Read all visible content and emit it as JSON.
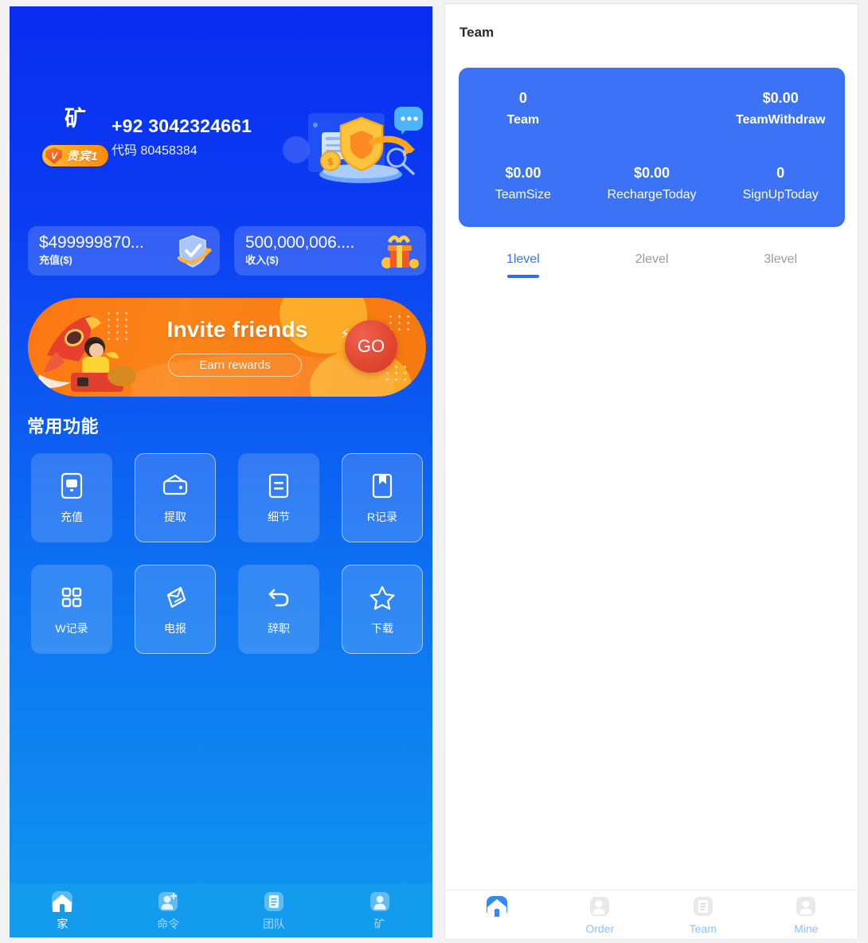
{
  "left_app": {
    "profile": {
      "avatar_name": "矿",
      "vip_mark": "V",
      "vip_label": "贵宾1",
      "phone": "+92 3042324661",
      "invite_code_text": "代码 80458384"
    },
    "balances": [
      {
        "amount": "$499999870...",
        "label": "充值($)",
        "icon": "shield-check-icon"
      },
      {
        "amount": "500,000,006....",
        "label": "收入($)",
        "icon": "gift-box-icon"
      }
    ],
    "banner": {
      "title": "Invite friends",
      "subtitle": "Earn rewards",
      "cta": "GO",
      "icon": "rocket-icon"
    },
    "section_title": "常用功能",
    "functions": [
      {
        "label": "充值",
        "icon": "monitor-icon",
        "style": "filled"
      },
      {
        "label": "提取",
        "icon": "wallet-icon",
        "style": "outlined"
      },
      {
        "label": "细节",
        "icon": "document-lines-icon",
        "style": "filled"
      },
      {
        "label": "R记录",
        "icon": "bookmark-book-icon",
        "style": "outlined"
      },
      {
        "label": "W记录",
        "icon": "grid-squares-icon",
        "style": "filled"
      },
      {
        "label": "电报",
        "icon": "send-card-icon",
        "style": "outlined"
      },
      {
        "label": "辞职",
        "icon": "undo-arrow-icon",
        "style": "filled"
      },
      {
        "label": "下载",
        "icon": "star-icon",
        "style": "outlined"
      }
    ],
    "bottom_nav": [
      {
        "label": "家",
        "icon": "home-icon",
        "active": true
      },
      {
        "label": "命令",
        "icon": "user-plus-icon",
        "active": false
      },
      {
        "label": "团队",
        "icon": "document-icon",
        "active": false
      },
      {
        "label": "矿",
        "icon": "user-icon",
        "active": false
      }
    ]
  },
  "right_app": {
    "page_title": "Team",
    "team_card": {
      "row1": [
        {
          "value": "0",
          "key": "Team"
        },
        {
          "value": "",
          "key": ""
        },
        {
          "value": "$0.00",
          "key": "TeamWithdraw"
        }
      ],
      "row2": [
        {
          "value": "$0.00",
          "key": "TeamSize"
        },
        {
          "value": "$0.00",
          "key": "RechargeToday"
        },
        {
          "value": "0",
          "key": "SignUpToday"
        }
      ]
    },
    "level_tabs": [
      {
        "label": "1level",
        "active": true
      },
      {
        "label": "2level",
        "active": false
      },
      {
        "label": "3level",
        "active": false
      }
    ],
    "bottom_nav": [
      {
        "label": "Home",
        "icon": "home-icon",
        "active": true
      },
      {
        "label": "Order",
        "icon": "user-plus-icon",
        "active": false
      },
      {
        "label": "Team",
        "icon": "document-icon",
        "active": false
      },
      {
        "label": "Mine",
        "icon": "user-icon",
        "active": false
      }
    ]
  },
  "theme": {
    "left_bg_top": "#0a2cf0",
    "left_bg_bottom": "#1097ee",
    "card_blue": "#3b72f6",
    "accent": "#2f6bf3",
    "banner_orange": "#fb8518",
    "vip_gold": "#ff9f1a"
  }
}
